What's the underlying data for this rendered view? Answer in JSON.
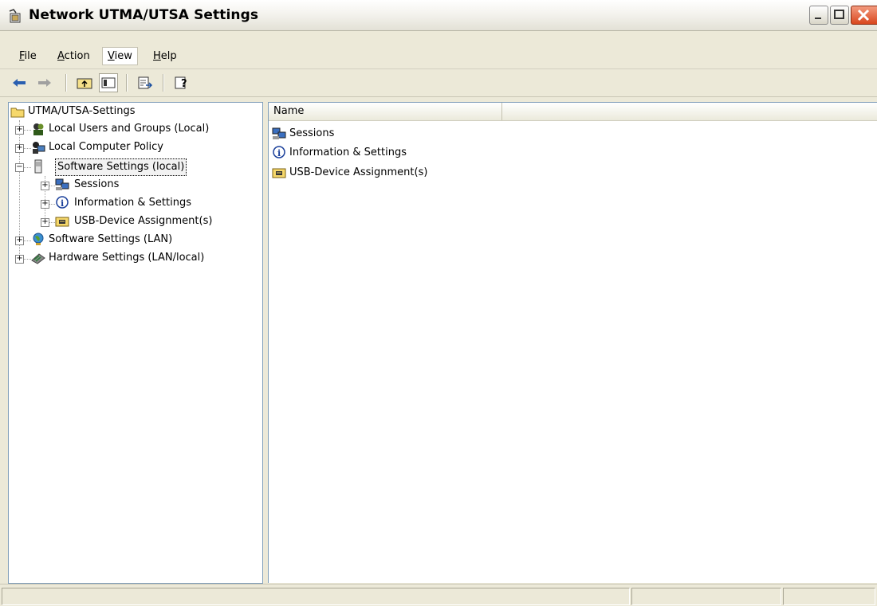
{
  "window": {
    "title": "Network UTMA/UTSA Settings"
  },
  "menu": [
    {
      "label": "File",
      "mnemonic": "F",
      "rest": "ile"
    },
    {
      "label": "Action",
      "mnemonic": "A",
      "rest": "ction"
    },
    {
      "label": "View",
      "mnemonic": "V",
      "rest": "iew",
      "active": true
    },
    {
      "label": "Help",
      "mnemonic": "H",
      "rest": "elp"
    }
  ],
  "toolbar": [
    {
      "name": "back-arrow-icon"
    },
    {
      "name": "forward-arrow-icon"
    },
    {
      "name": "up-one-level-icon"
    },
    {
      "name": "show-hide-tree-icon",
      "pressed": true
    },
    {
      "name": "export-list-icon"
    },
    {
      "name": "help-icon"
    }
  ],
  "tree": {
    "root": "UTMA/UTSA-Settings",
    "items": [
      {
        "label": "Local Users and Groups (Local)",
        "icon": "users-groups-icon"
      },
      {
        "label": "Local Computer Policy",
        "icon": "computer-policy-icon"
      },
      {
        "label": "Software Settings (local)",
        "icon": "server-icon",
        "selected": true,
        "expanded": true,
        "children": [
          {
            "label": "Sessions",
            "icon": "sessions-icon"
          },
          {
            "label": "Information & Settings",
            "icon": "info-icon"
          },
          {
            "label": "USB-Device Assignment(s)",
            "icon": "usb-device-icon"
          }
        ]
      },
      {
        "label": "Software Settings (LAN)",
        "icon": "globe-icon"
      },
      {
        "label": "Hardware Settings (LAN/local)",
        "icon": "hardware-icon"
      }
    ]
  },
  "list": {
    "column_header": "Name",
    "items": [
      {
        "label": "Sessions",
        "icon": "sessions-icon"
      },
      {
        "label": "Information & Settings",
        "icon": "info-icon"
      },
      {
        "label": "USB-Device Assignment(s)",
        "icon": "usb-device-icon"
      }
    ]
  },
  "colors": {
    "pane_border": "#7f9db9",
    "chrome": "#ece9d8",
    "close_button": "#d8461e"
  }
}
